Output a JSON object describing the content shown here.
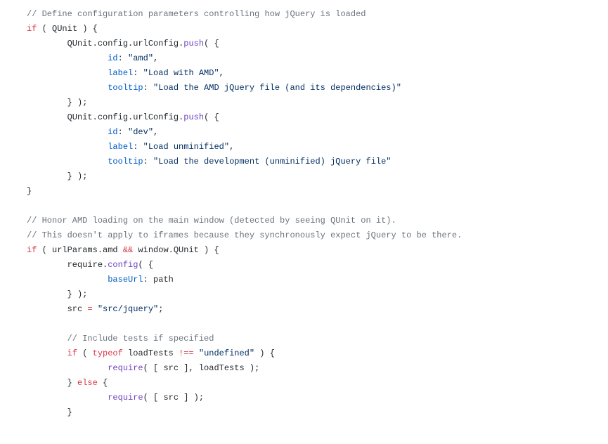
{
  "lines": [
    [
      {
        "t": "comment",
        "v": "// Define configuration parameters controlling how jQuery is loaded"
      }
    ],
    [
      {
        "t": "keyword",
        "v": "if"
      },
      {
        "t": "plain",
        "v": " ( QUnit ) {"
      }
    ],
    [
      {
        "t": "plain",
        "v": "        QUnit.config.urlConfig."
      },
      {
        "t": "func",
        "v": "push"
      },
      {
        "t": "plain",
        "v": "( {"
      }
    ],
    [
      {
        "t": "plain",
        "v": "                "
      },
      {
        "t": "prop",
        "v": "id"
      },
      {
        "t": "plain",
        "v": ": "
      },
      {
        "t": "string",
        "v": "\"amd\""
      },
      {
        "t": "plain",
        "v": ","
      }
    ],
    [
      {
        "t": "plain",
        "v": "                "
      },
      {
        "t": "prop",
        "v": "label"
      },
      {
        "t": "plain",
        "v": ": "
      },
      {
        "t": "string",
        "v": "\"Load with AMD\""
      },
      {
        "t": "plain",
        "v": ","
      }
    ],
    [
      {
        "t": "plain",
        "v": "                "
      },
      {
        "t": "prop",
        "v": "tooltip"
      },
      {
        "t": "plain",
        "v": ": "
      },
      {
        "t": "string",
        "v": "\"Load the AMD jQuery file (and its dependencies)\""
      }
    ],
    [
      {
        "t": "plain",
        "v": "        } );"
      }
    ],
    [
      {
        "t": "plain",
        "v": "        QUnit.config.urlConfig."
      },
      {
        "t": "func",
        "v": "push"
      },
      {
        "t": "plain",
        "v": "( {"
      }
    ],
    [
      {
        "t": "plain",
        "v": "                "
      },
      {
        "t": "prop",
        "v": "id"
      },
      {
        "t": "plain",
        "v": ": "
      },
      {
        "t": "string",
        "v": "\"dev\""
      },
      {
        "t": "plain",
        "v": ","
      }
    ],
    [
      {
        "t": "plain",
        "v": "                "
      },
      {
        "t": "prop",
        "v": "label"
      },
      {
        "t": "plain",
        "v": ": "
      },
      {
        "t": "string",
        "v": "\"Load unminified\""
      },
      {
        "t": "plain",
        "v": ","
      }
    ],
    [
      {
        "t": "plain",
        "v": "                "
      },
      {
        "t": "prop",
        "v": "tooltip"
      },
      {
        "t": "plain",
        "v": ": "
      },
      {
        "t": "string",
        "v": "\"Load the development (unminified) jQuery file\""
      }
    ],
    [
      {
        "t": "plain",
        "v": "        } );"
      }
    ],
    [
      {
        "t": "plain",
        "v": "}"
      }
    ],
    [
      {
        "t": "plain",
        "v": ""
      }
    ],
    [
      {
        "t": "comment",
        "v": "// Honor AMD loading on the main window (detected by seeing QUnit on it)."
      }
    ],
    [
      {
        "t": "comment",
        "v": "// This doesn't apply to iframes because they synchronously expect jQuery to be there."
      }
    ],
    [
      {
        "t": "keyword",
        "v": "if"
      },
      {
        "t": "plain",
        "v": " ( urlParams.amd "
      },
      {
        "t": "keyword",
        "v": "&&"
      },
      {
        "t": "plain",
        "v": " window.QUnit ) {"
      }
    ],
    [
      {
        "t": "plain",
        "v": "        require."
      },
      {
        "t": "func",
        "v": "config"
      },
      {
        "t": "plain",
        "v": "( {"
      }
    ],
    [
      {
        "t": "plain",
        "v": "                "
      },
      {
        "t": "prop",
        "v": "baseUrl"
      },
      {
        "t": "plain",
        "v": ": path"
      }
    ],
    [
      {
        "t": "plain",
        "v": "        } );"
      }
    ],
    [
      {
        "t": "plain",
        "v": "        src "
      },
      {
        "t": "keyword",
        "v": "="
      },
      {
        "t": "plain",
        "v": " "
      },
      {
        "t": "string",
        "v": "\"src/jquery\""
      },
      {
        "t": "plain",
        "v": ";"
      }
    ],
    [
      {
        "t": "plain",
        "v": ""
      }
    ],
    [
      {
        "t": "plain",
        "v": "        "
      },
      {
        "t": "comment",
        "v": "// Include tests if specified"
      }
    ],
    [
      {
        "t": "plain",
        "v": "        "
      },
      {
        "t": "keyword",
        "v": "if"
      },
      {
        "t": "plain",
        "v": " ( "
      },
      {
        "t": "keyword",
        "v": "typeof"
      },
      {
        "t": "plain",
        "v": " loadTests "
      },
      {
        "t": "keyword",
        "v": "!=="
      },
      {
        "t": "plain",
        "v": " "
      },
      {
        "t": "string",
        "v": "\"undefined\""
      },
      {
        "t": "plain",
        "v": " ) {"
      }
    ],
    [
      {
        "t": "plain",
        "v": "                "
      },
      {
        "t": "func",
        "v": "require"
      },
      {
        "t": "plain",
        "v": "( [ src ], loadTests );"
      }
    ],
    [
      {
        "t": "plain",
        "v": "        } "
      },
      {
        "t": "keyword",
        "v": "else"
      },
      {
        "t": "plain",
        "v": " {"
      }
    ],
    [
      {
        "t": "plain",
        "v": "                "
      },
      {
        "t": "func",
        "v": "require"
      },
      {
        "t": "plain",
        "v": "( [ src ] );"
      }
    ],
    [
      {
        "t": "plain",
        "v": "        }"
      }
    ]
  ]
}
